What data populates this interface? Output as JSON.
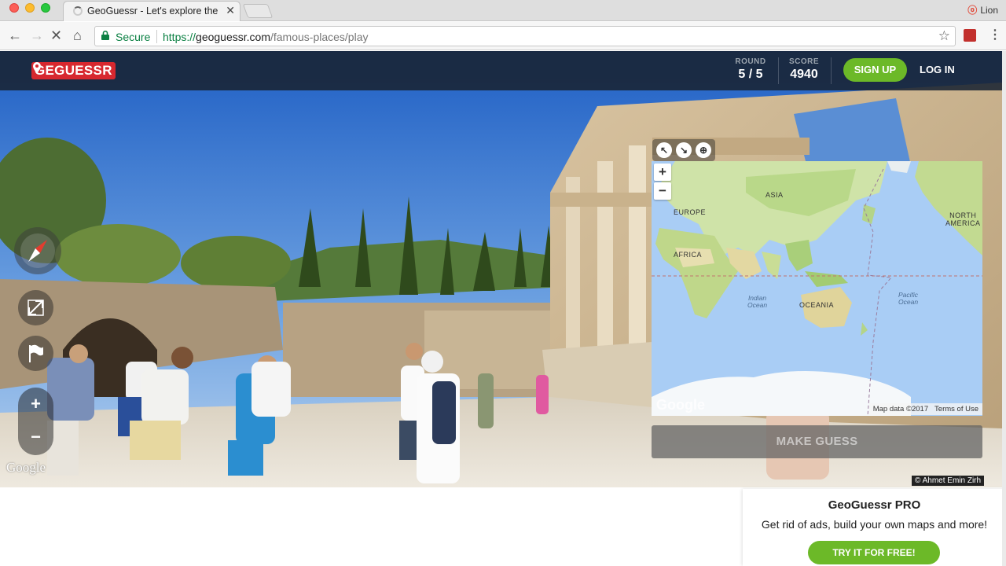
{
  "browser": {
    "tab_title": "GeoGuessr - Let's explore the",
    "profile_name": "Lion",
    "secure_label": "Secure",
    "url_scheme": "https://",
    "url_host": "geoguessr.com",
    "url_path": "/famous-places/play"
  },
  "header": {
    "logo_left": "GE",
    "logo_right": "GUESSR",
    "round_label": "ROUND",
    "round_value": "5 / 5",
    "score_label": "SCORE",
    "score_value": "4940",
    "signup_label": "SIGN UP",
    "login_label": "LOG IN",
    "brand_color": "#d7282f",
    "accent_color": "#6cb928"
  },
  "streetview": {
    "watermark": "Google",
    "credit": "© Ahmet Emin Zirh",
    "controls": [
      "compass-icon",
      "fullscreen-icon",
      "flag-icon",
      "plus-icon",
      "minus-icon"
    ]
  },
  "map": {
    "labels": {
      "europe": "EUROPE",
      "asia": "ASIA",
      "africa": "AFRICA",
      "oceania": "OCEANIA",
      "north_america_1": "NORTH",
      "north_america_2": "AMERICA",
      "indian_1": "Indian",
      "indian_2": "Ocean",
      "pacific_1": "Pacific",
      "pacific_2": "Ocean"
    },
    "zoom_in": "+",
    "zoom_out": "−",
    "watermark": "Google",
    "map_data": "Map data ©2017",
    "terms": "Terms of Use",
    "make_guess": "MAKE GUESS"
  },
  "promo": {
    "title": "GeoGuessr PRO",
    "text": "Get rid of ads, build your own maps and more!",
    "button": "TRY IT FOR FREE!"
  }
}
